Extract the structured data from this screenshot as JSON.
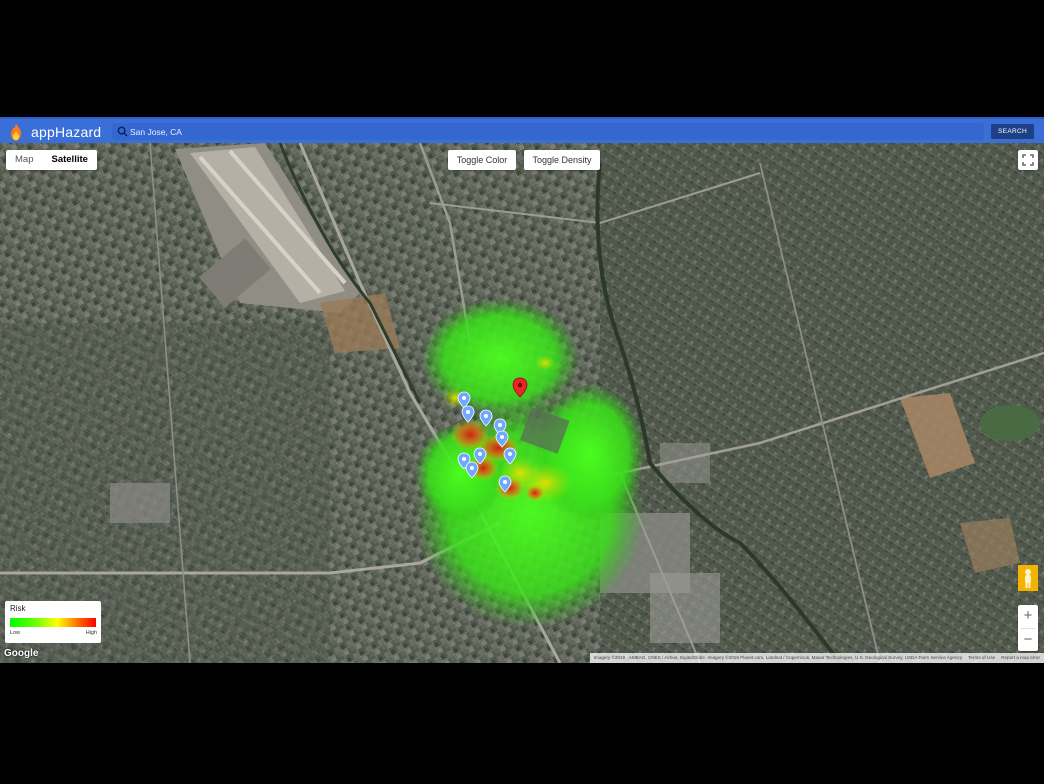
{
  "header": {
    "title": "appHazard",
    "search_value": "San Jose, CA",
    "search_placeholder": "",
    "search_button": "SEARCH"
  },
  "map_controls": {
    "map_type": [
      "Map",
      "Satellite"
    ],
    "selected_map_type": "Satellite",
    "toggle_color": "Toggle Color",
    "toggle_density": "Toggle Density",
    "zoom_in": "+",
    "zoom_out": "−"
  },
  "legend": {
    "title": "Risk",
    "low_label": "Low",
    "high_label": "High"
  },
  "footer": {
    "google": "Google",
    "imagery": "Imagery ©2019 , AMBAG, CNES / Airbus, DigitalGlobe, Imagery ©2019 Planet.com, Landsat / Copernicus, Maxar Technologies, U.S. Geological Survey, USDA Farm Service Agency",
    "terms": "Terms of Use",
    "report": "Report a map error"
  },
  "colors": {
    "header_bg": "#3a6fd8",
    "search_button_bg": "#1f3f87",
    "marker_blue": "#6fa8ff",
    "marker_red": "#e8262a"
  }
}
